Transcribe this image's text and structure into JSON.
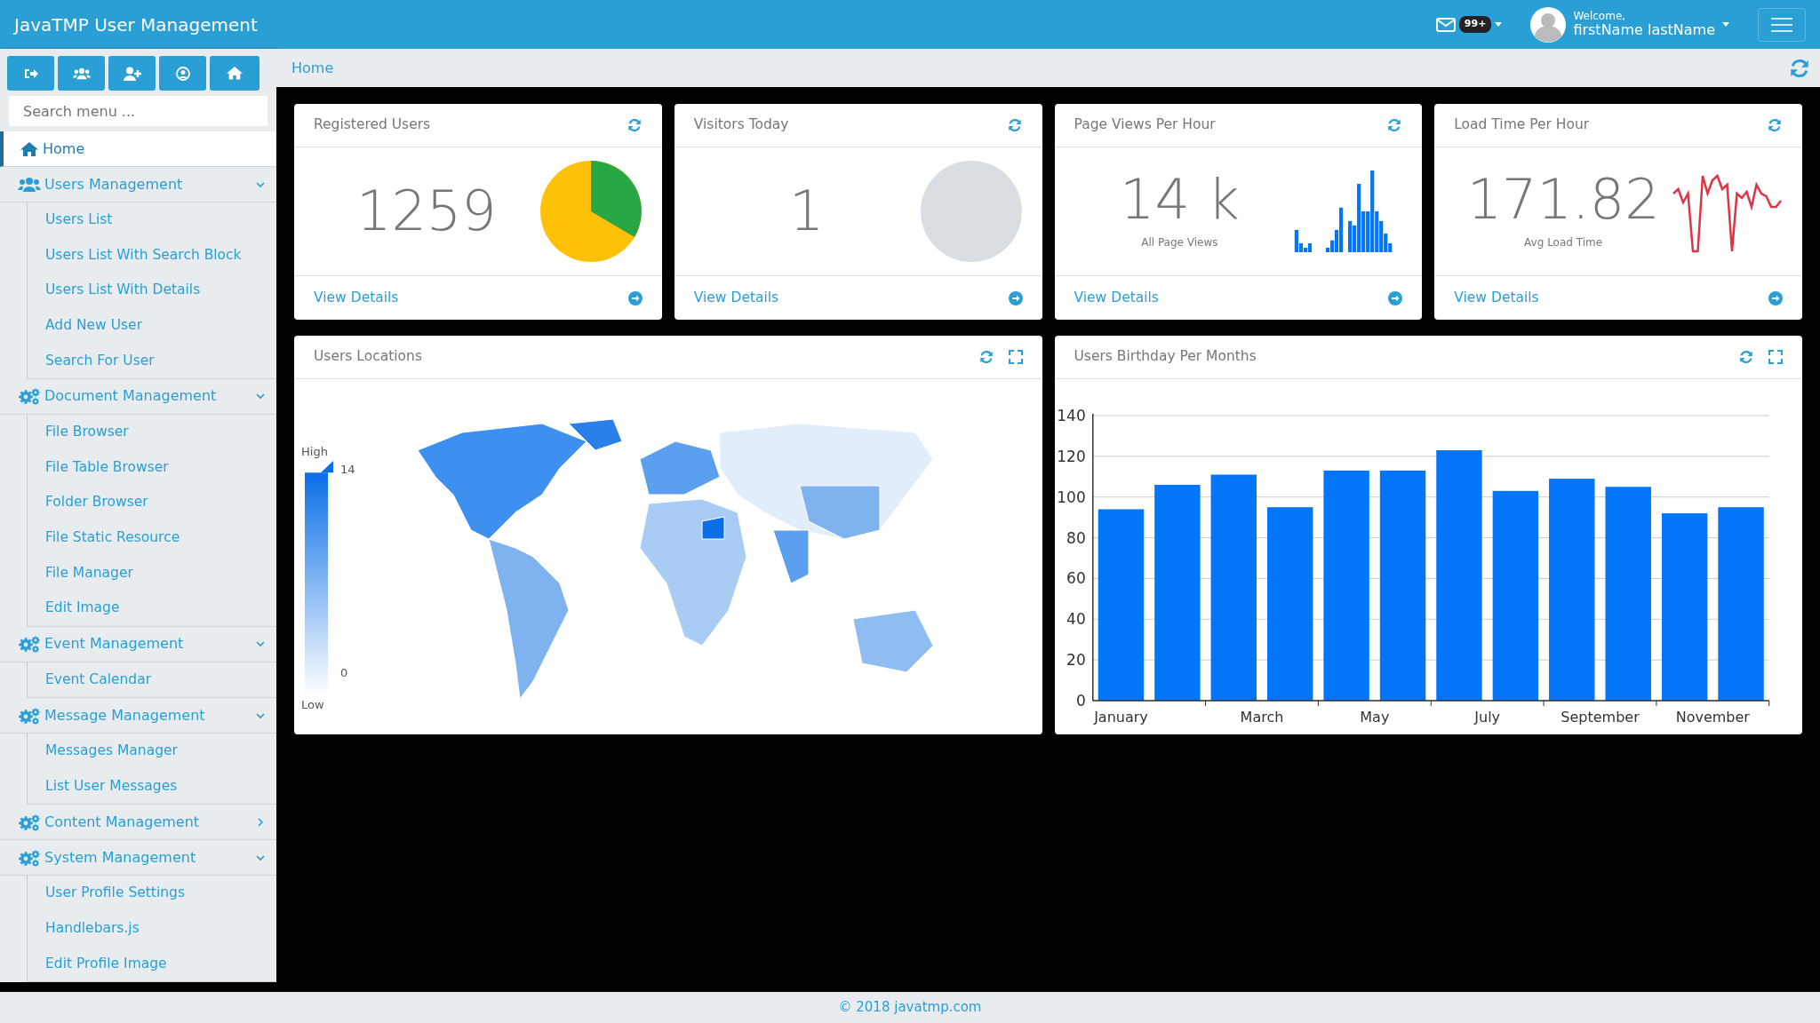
{
  "app_title": "JavaTMP User Management",
  "header": {
    "message_badge": "99+",
    "welcome": "Welcome,",
    "user_name": "firstName lastName"
  },
  "sidebar": {
    "search": {
      "placeholder": "Search menu ..."
    },
    "items": [
      {
        "label": "Home",
        "selected": true
      },
      {
        "label": "Users Management",
        "selected": false,
        "expanded": true,
        "children": [
          {
            "label": "Users List"
          },
          {
            "label": "Users List With Search Block"
          },
          {
            "label": "Users List With Details"
          },
          {
            "label": "Add New User"
          },
          {
            "label": "Search For User"
          }
        ]
      },
      {
        "label": "Document Management",
        "selected": false,
        "expanded": true,
        "children": [
          {
            "label": "File Browser"
          },
          {
            "label": "File Table Browser"
          },
          {
            "label": "Folder Browser"
          },
          {
            "label": "File Static Resource"
          },
          {
            "label": "File Manager"
          },
          {
            "label": "Edit Image"
          }
        ]
      },
      {
        "label": "Event Management",
        "selected": false,
        "expanded": true,
        "children": [
          {
            "label": "Event Calendar"
          }
        ]
      },
      {
        "label": "Message Management",
        "selected": false,
        "expanded": true,
        "children": [
          {
            "label": "Messages Manager"
          },
          {
            "label": "List User Messages"
          }
        ]
      },
      {
        "label": "Content Management",
        "selected": false,
        "expanded": false
      },
      {
        "label": "System Management",
        "selected": false,
        "expanded": true,
        "children": [
          {
            "label": "User Profile Settings"
          },
          {
            "label": "Handlebars.js"
          },
          {
            "label": "Edit Profile Image"
          }
        ]
      }
    ]
  },
  "breadcrumb": "Home",
  "stat_cards": [
    {
      "kind": "pie",
      "title": "Registered Users",
      "value": "1259",
      "link": "View Details"
    },
    {
      "kind": "circle",
      "title": "Visitors Today",
      "value": "1",
      "link": "View Details"
    },
    {
      "kind": "bars",
      "title": "Page Views Per Hour",
      "value": "14 k",
      "caption": "All Page Views",
      "link": "View Details"
    },
    {
      "kind": "line",
      "title": "Load Time Per Hour",
      "value": "171.82",
      "caption": "Avg Load Time",
      "link": "View Details"
    }
  ],
  "map_panel": {
    "title": "Users Locations",
    "legend": {
      "high": "High",
      "max": "14",
      "min": "0",
      "low": "Low"
    }
  },
  "chart_panel": {
    "title": "Users Birthday Per Months",
    "chart_data": {
      "type": "bar",
      "categories": [
        "January",
        null,
        "March",
        null,
        "May",
        null,
        "July",
        null,
        "September",
        null,
        "November",
        null
      ],
      "values": [
        94,
        106,
        111,
        95,
        113,
        113,
        123,
        103,
        109,
        105,
        92,
        95
      ],
      "grid": true,
      "ylim": [
        0,
        140
      ],
      "yticks": [
        0,
        20,
        40,
        60,
        80,
        100,
        120,
        140
      ]
    }
  },
  "footer": "© 2018 javatmp.com"
}
